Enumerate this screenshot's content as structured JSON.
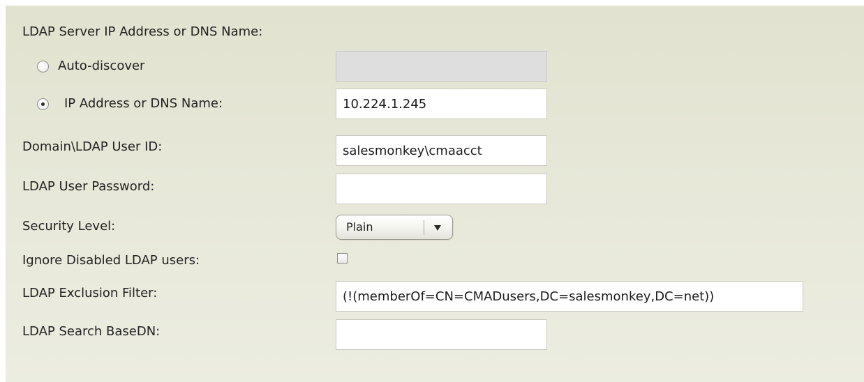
{
  "form": {
    "server_heading": "LDAP Server IP Address or DNS Name:",
    "auto_discover": {
      "label": "Auto-discover",
      "selected": false,
      "value": ""
    },
    "ip_or_dns": {
      "label": "IP Address or DNS Name:",
      "selected": true,
      "value": "10.224.1.245"
    },
    "user_id": {
      "label": "Domain\\LDAP User ID:",
      "value": "salesmonkey\\cmaacct"
    },
    "password": {
      "label": "LDAP User Password:",
      "value": ""
    },
    "security_level": {
      "label": "Security Level:",
      "selected": "Plain",
      "icon": "dropdown-arrow-icon"
    },
    "ignore_disabled": {
      "label": "Ignore Disabled LDAP users:",
      "checked": false
    },
    "exclusion_filter": {
      "label": "LDAP Exclusion Filter:",
      "value": "(!(memberOf=CN=CMADusers,DC=salesmonkey,DC=net))"
    },
    "search_basedn": {
      "label": "LDAP Search BaseDN:",
      "value": ""
    }
  },
  "colors": {
    "panel_background": "#e4e5d3",
    "input_background": "#ffffff",
    "disabled_input_background": "#dedede",
    "text": "#1f1f1f"
  }
}
